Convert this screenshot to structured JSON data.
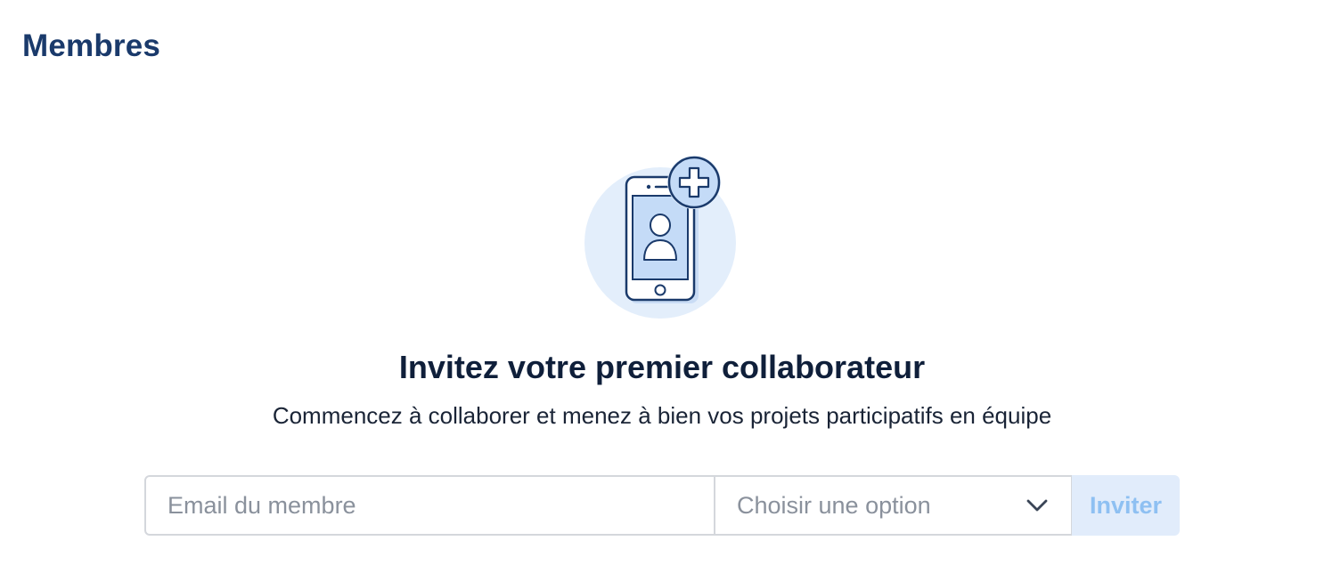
{
  "header": {
    "title": "Membres"
  },
  "empty_state": {
    "illustration_icon": "phone-add-user-icon",
    "title": "Invitez votre premier collaborateur",
    "subtitle": "Commencez à collaborer et menez à bien vos projets participatifs en équipe"
  },
  "invite_form": {
    "email": {
      "value": "",
      "placeholder": "Email du membre"
    },
    "role_select": {
      "selected_label": "Choisir une option",
      "icon": "chevron-down-icon"
    },
    "submit_label": "Inviter",
    "submit_disabled": true
  },
  "colors": {
    "title": "#1a3a6b",
    "heading": "#0f1f3a",
    "illustration_bg": "#e3eefb",
    "illustration_stroke": "#1a3a6b",
    "button_bg_disabled": "#e1ecfb",
    "button_text_disabled": "#8ec0f2",
    "input_border": "#d4d7dc",
    "placeholder": "#8a919c"
  }
}
